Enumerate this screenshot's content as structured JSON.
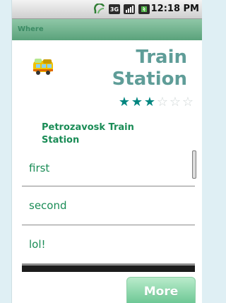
{
  "status_bar": {
    "time": "12:18 PM",
    "icons": [
      "sync-icon",
      "network-3g-icon",
      "signal-bars-icon",
      "battery-icon"
    ]
  },
  "title_bar": {
    "text": "Where"
  },
  "header": {
    "icon": "bus-icon",
    "title": "Train Station",
    "rating": {
      "value": 3,
      "max": 6,
      "filled_color": "#00857f",
      "empty_color": "#cfd6d6"
    }
  },
  "place": {
    "name": "Petrozavosk Train Station"
  },
  "list": {
    "items": [
      {
        "label": "first"
      },
      {
        "label": "second"
      },
      {
        "label": "lol!"
      }
    ]
  },
  "actions": {
    "more_label": "More"
  },
  "colors": {
    "accent_green": "#1a8c56",
    "title_teal": "#5f9d98",
    "page_background": "#dfeff4"
  }
}
